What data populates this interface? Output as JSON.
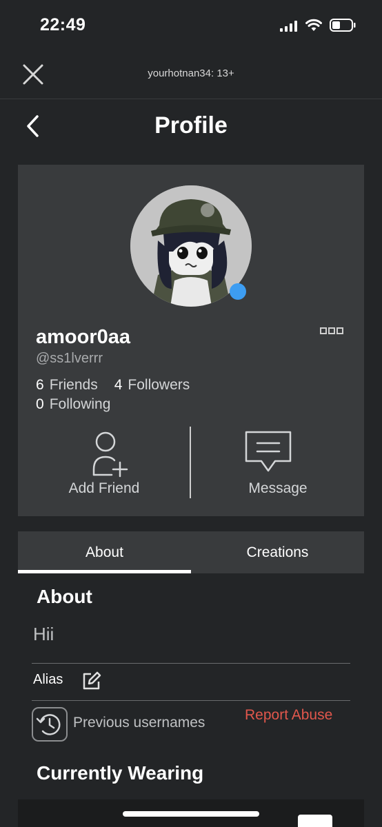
{
  "status_bar": {
    "time": "22:49"
  },
  "topbar": {
    "title": "yourhotnan34: 13+"
  },
  "header": {
    "title": "Profile"
  },
  "profile": {
    "display_name": "amoor0aa",
    "username": "@ss1lverrr",
    "friends_count": "6",
    "friends_label": "Friends",
    "followers_count": "4",
    "followers_label": "Followers",
    "following_count": "0",
    "following_label": "Following",
    "online": true
  },
  "actions": {
    "add_friend": "Add Friend",
    "message": "Message"
  },
  "tabs": [
    {
      "label": "About",
      "active": true
    },
    {
      "label": "Creations",
      "active": false
    }
  ],
  "about": {
    "heading": "About",
    "bio": "Hii",
    "alias_label": "Alias",
    "previous_usernames": "Previous usernames",
    "report_abuse": "Report Abuse",
    "currently_wearing": "Currently Wearing"
  },
  "colors": {
    "background": "#232527",
    "card": "#393b3d",
    "presence": "#3d9df2",
    "report": "#e2574c"
  }
}
